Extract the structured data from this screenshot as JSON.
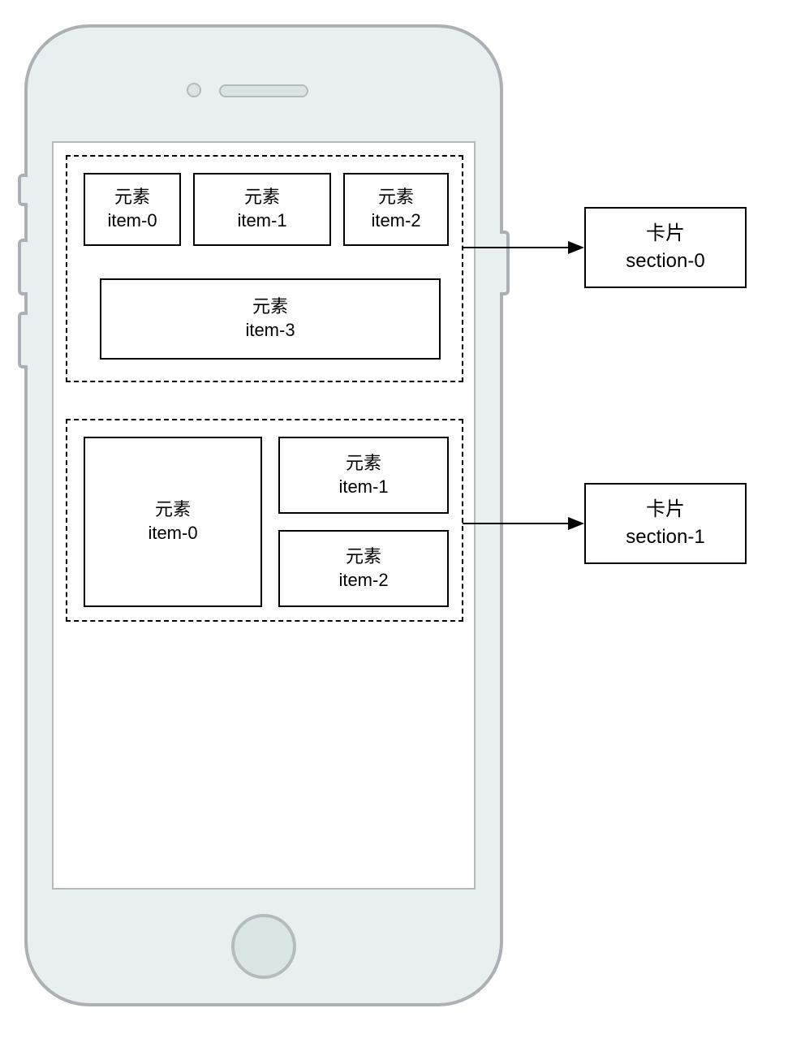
{
  "phone": {
    "section0": {
      "items": [
        {
          "title": "元素",
          "subtitle": "item-0"
        },
        {
          "title": "元素",
          "subtitle": "item-1"
        },
        {
          "title": "元素",
          "subtitle": "item-2"
        },
        {
          "title": "元素",
          "subtitle": "item-3"
        }
      ]
    },
    "section1": {
      "items": [
        {
          "title": "元素",
          "subtitle": "item-0"
        },
        {
          "title": "元素",
          "subtitle": "item-1"
        },
        {
          "title": "元素",
          "subtitle": "item-2"
        }
      ]
    }
  },
  "labels": {
    "section0": {
      "title": "卡片",
      "subtitle": "section-0"
    },
    "section1": {
      "title": "卡片",
      "subtitle": "section-1"
    }
  }
}
